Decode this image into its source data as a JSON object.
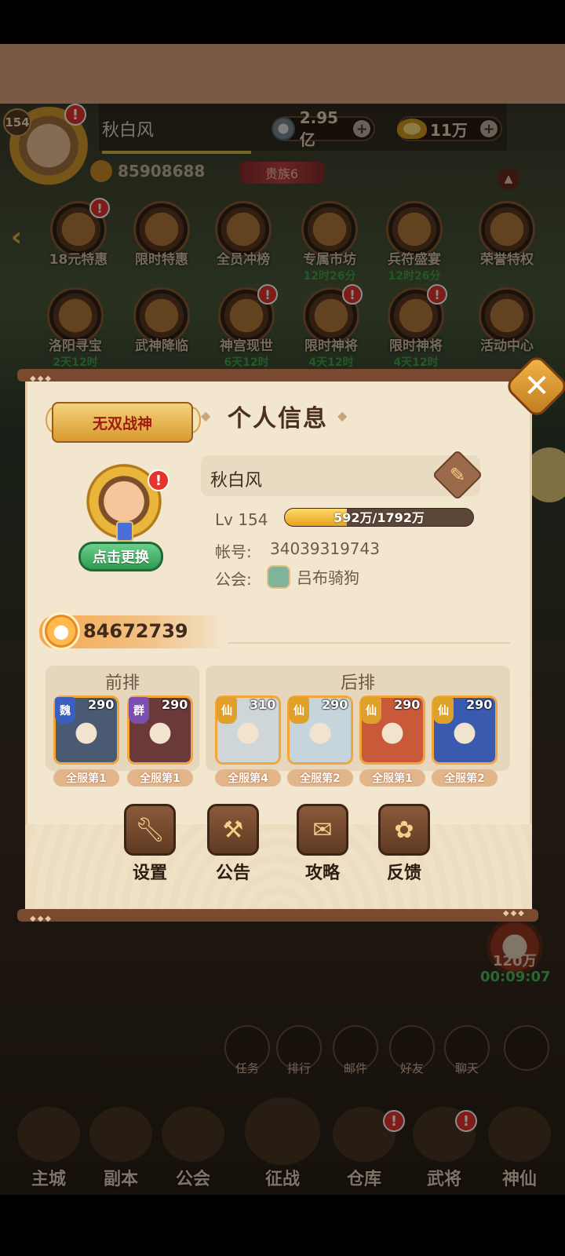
{
  "hud": {
    "level": "154",
    "player_name": "秋白风",
    "currency1": "2.95亿",
    "currency2": "11万",
    "power": "85908688",
    "noble": "贵族6",
    "alert": "!"
  },
  "events": [
    {
      "label": "18元特惠",
      "sub": ""
    },
    {
      "label": "限时特惠",
      "sub": ""
    },
    {
      "label": "全员冲榜",
      "sub": ""
    },
    {
      "label": "专属市坊",
      "sub": "12时26分"
    },
    {
      "label": "兵符盛宴",
      "sub": "12时26分"
    },
    {
      "label": "荣誉特权",
      "sub": ""
    },
    {
      "label": "洛阳寻宝",
      "sub": "2天12时"
    },
    {
      "label": "武神降临",
      "sub": ""
    },
    {
      "label": "神宫现世",
      "sub": "6天12时"
    },
    {
      "label": "限时神将",
      "sub": "4天12时"
    },
    {
      "label": "限时神将",
      "sub": "4天12时"
    },
    {
      "label": "活动中心",
      "sub": ""
    }
  ],
  "modal": {
    "title": "个人信息",
    "title_badge": "无双战神",
    "change_button": "点击更换",
    "name": "秋白风",
    "level_label": "Lv 154",
    "xp_text": "592万/1792万",
    "xp_fraction": 0.33,
    "account_label": "帐号:",
    "account_value": "34039319743",
    "guild_label": "公会:",
    "guild_value": "吕布骑狗",
    "power": "84672739",
    "front_label": "前排",
    "back_label": "后排",
    "heroes": [
      {
        "faction": "魏",
        "level": "290",
        "rank": "全服第1",
        "faction_color": "#3a5fc0",
        "bg": "#4a5a72"
      },
      {
        "faction": "群",
        "level": "290",
        "rank": "全服第1",
        "faction_color": "#7a4fb0",
        "bg": "#6a3a3a"
      },
      {
        "faction": "仙",
        "level": "310",
        "rank": "全服第4",
        "faction_color": "#e0a12a",
        "bg": "#cfd6d9"
      },
      {
        "faction": "仙",
        "level": "290",
        "rank": "全服第2",
        "faction_color": "#e0a12a",
        "bg": "#c6d4dc"
      },
      {
        "faction": "仙",
        "level": "290",
        "rank": "全服第1",
        "faction_color": "#e0a12a",
        "bg": "#c85a3a"
      },
      {
        "faction": "仙",
        "level": "290",
        "rank": "全服第2",
        "faction_color": "#e0a12a",
        "bg": "#3a5ab0"
      }
    ],
    "functions": [
      {
        "label": "设置",
        "icon": "wrench-icon"
      },
      {
        "label": "公告",
        "icon": "hammer-icon"
      },
      {
        "label": "攻略",
        "icon": "scroll-icon"
      },
      {
        "label": "反馈",
        "icon": "cat-icon"
      }
    ]
  },
  "lower": {
    "coin_amount": "120万",
    "timer": "00:09:07",
    "mini": [
      "任务",
      "排行",
      "邮件",
      "好友",
      "聊天"
    ]
  },
  "tabs": [
    "主城",
    "副本",
    "公会",
    "征战",
    "仓库",
    "武将",
    "神仙"
  ]
}
